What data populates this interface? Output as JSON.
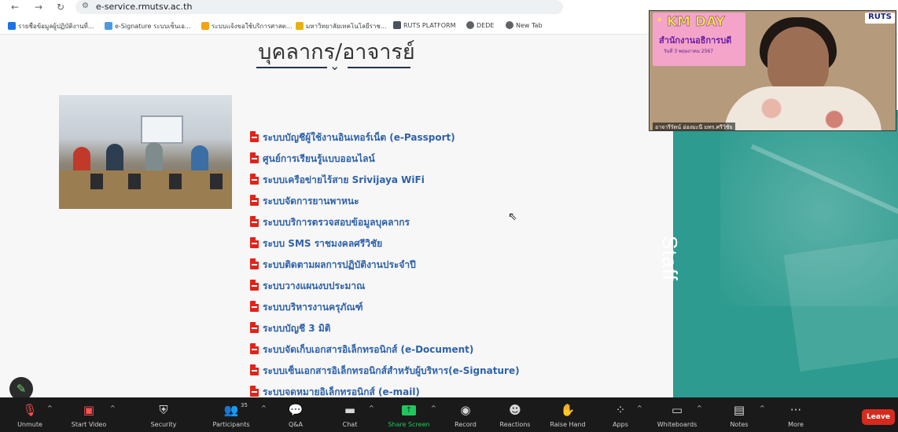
{
  "browser": {
    "url": "e-service.rmutsv.ac.th",
    "bookmarks": [
      {
        "label": "รายชื่อข้อมูลผู้ปฏิบัติงานที่...",
        "color": "#1a73e8"
      },
      {
        "label": "e-Signature ระบบเซ็นเอ...",
        "color": "#4a9be0"
      },
      {
        "label": "ระบบแจ้งขอใช้บริการศาสต...",
        "color": "#f2a413"
      },
      {
        "label": "มหาวิทยาลัยเทคโนโลยีราช...",
        "color": "#e8b10b"
      },
      {
        "label": "RUTS PLATFORM",
        "color": "#4a5260"
      },
      {
        "label": "DEDE",
        "color": "#5f6368"
      },
      {
        "label": "New Tab",
        "color": "#5f6368"
      }
    ]
  },
  "page": {
    "title": "บุคลากร/อาจารย์",
    "staff_label": "Staff",
    "links": [
      "ระบบบัญชีผู้ใช้งานอินเทอร์เน็ต (e-Passport)",
      "ศูนย์การเรียนรู้แบบออนไลน์",
      "ระบบเครือข่ายไร้สาย Srivijaya WiFi",
      "ระบบจัดการยานพาหนะ",
      "ระบบบริการตรวจสอบข้อมูลบุคลากร",
      "ระบบ SMS ราชมงคลศรีวิชัย",
      "ระบบติดตามผลการปฏิบัติงานประจำปี",
      "ระบบวางแผนงบประมาณ",
      "ระบบบริหารงานครุภัณฑ์",
      "ระบบบัญชี 3 มิติ",
      "ระบบจัดเก็บเอกสารอิเล็กทรอนิกส์ (e-Document)",
      "ระบบเซ็นเอกสารอิเล็กทรอนิกส์สำหรับผู้บริหาร(e-Signature)",
      "ระบบจดหมายอิเล็กทรอนิกส์ (e-mail)"
    ]
  },
  "video": {
    "banner_title": "KM DAY",
    "banner_subtitle": "สำนักงานอธิการบดี",
    "banner_date": "วันที่ 3 พฤษภาคม 2567",
    "logo": "RUTS",
    "participant_name": "อาจารีรัตน์ อ่องมะนี มทร.ศรีวิชัย"
  },
  "toolbar": {
    "unmute": "Unmute",
    "start_video": "Start Video",
    "security": "Security",
    "participants": "Participants",
    "participants_count": "35",
    "qa": "Q&A",
    "chat": "Chat",
    "share_screen": "Share Screen",
    "record": "Record",
    "reactions": "Reactions",
    "raise_hand": "Raise Hand",
    "apps": "Apps",
    "whiteboards": "Whiteboards",
    "notes": "Notes",
    "more": "More",
    "leave": "Leave"
  }
}
